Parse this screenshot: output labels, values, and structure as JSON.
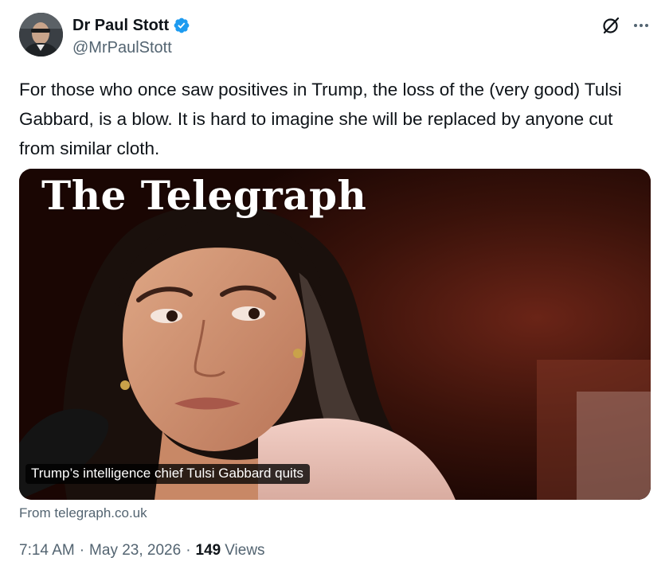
{
  "author": {
    "display_name": "Dr Paul Stott",
    "handle": "@MrPaulStott",
    "verified": true,
    "verified_color": "#1d9bf0"
  },
  "icons": {
    "verified": "verified-badge-icon",
    "grok": "grok-icon",
    "more": "more-icon"
  },
  "tweet": {
    "text": "For those who once saw positives in Trump, the loss of the (very good) Tulsi Gabbard, is a blow. It is hard to imagine she will be replaced by anyone cut from similar cloth."
  },
  "card": {
    "masthead": "The Telegraph",
    "caption": "Trump’s intelligence chief Tulsi Gabbard quits",
    "source": "From telegraph.co.uk"
  },
  "meta": {
    "time": "7:14 AM",
    "separator": "·",
    "date": "May 23, 2026",
    "views_count": "149",
    "views_label": "Views"
  }
}
